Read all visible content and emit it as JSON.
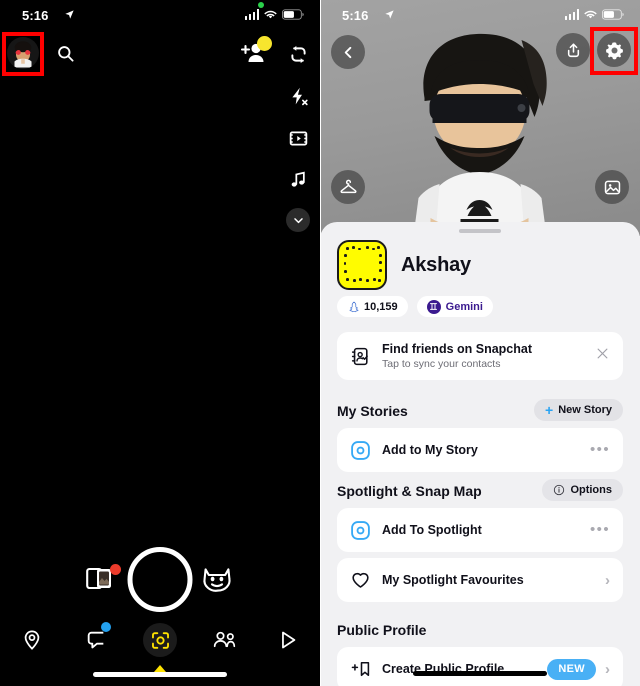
{
  "left_panel": {
    "status_bar": {
      "time": "5:16",
      "location_icon": "location-arrow-icon",
      "recording_dot": true
    },
    "top_bar": {
      "avatar_icon": "bitmoji-avatar-heart-eyes",
      "search_icon": "search-icon",
      "add_friend_icon": "add-friend-icon",
      "notification_dot_color": "#f7e52e",
      "flip_camera_icon": "flip-camera-icon",
      "flash_off_icon": "flash-off-icon",
      "timeline_icon": "timeline-icon",
      "music_icon": "music-note-icon",
      "expand_icon": "chevron-down-icon"
    },
    "capture": {
      "memories_icon": "memories-cards-icon",
      "memories_badge_color": "#ec3b2b",
      "shutter_icon": "shutter-button",
      "lens_icon": "lens-cat-face-icon"
    },
    "bottom_nav": [
      {
        "name": "map",
        "icon": "location-pin-icon",
        "active": false,
        "badge": false
      },
      {
        "name": "chat",
        "icon": "chat-bubble-icon",
        "active": false,
        "badge": true,
        "badge_color": "#23a1f0"
      },
      {
        "name": "camera",
        "icon": "camera-scan-icon",
        "active": true,
        "badge": false
      },
      {
        "name": "friends",
        "icon": "friends-icon",
        "active": false,
        "badge": false
      },
      {
        "name": "spotlight",
        "icon": "play-triangle-icon",
        "active": false,
        "badge": false
      }
    ]
  },
  "right_panel": {
    "status_bar": {
      "time": "5:16",
      "location_icon": "location-arrow-icon"
    },
    "hero": {
      "back_icon": "chevron-left-icon",
      "share_icon": "share-upload-icon",
      "settings_icon": "gear-icon",
      "wardrobe_icon": "hanger-icon",
      "background_icon": "photo-edit-icon",
      "avatar_icon": "bitmoji-3d-avatar"
    },
    "profile": {
      "snapcode_icon": "snapcode",
      "snapcode_color": "#fffc00",
      "display_name": "Akshay",
      "snapscore_icon": "snapchat-ghost-icon",
      "snapscore": "10,159",
      "zodiac_icon": "gemini-symbol",
      "zodiac": "Gemini",
      "zodiac_color": "#3b1a8f"
    },
    "find_friends": {
      "icon": "contacts-check-icon",
      "title": "Find friends on Snapchat",
      "subtitle": "Tap to sync your contacts",
      "close_icon": "close-x-icon"
    },
    "sections": [
      {
        "heading": "My Stories",
        "action": {
          "label": "New Story",
          "icon": "plus-icon"
        },
        "rows": [
          {
            "icon": "add-story-circle-icon",
            "label": "Add to My Story",
            "trailing": "more-dots-icon",
            "trailing_text": "•••"
          }
        ]
      },
      {
        "heading": "Spotlight & Snap Map",
        "action": {
          "label": "Options",
          "icon": "info-icon"
        },
        "rows": [
          {
            "icon": "add-spotlight-circle-icon",
            "label": "Add To Spotlight",
            "trailing": "more-dots-icon",
            "trailing_text": "•••"
          },
          {
            "icon": "heart-icon",
            "label": "My Spotlight Favourites",
            "trailing": "chevron-right-icon",
            "trailing_text": "›"
          }
        ]
      },
      {
        "heading": "Public Profile",
        "action": null,
        "rows": [
          {
            "icon": "add-bookmark-icon",
            "label": "Create Public Profile",
            "badge": "NEW",
            "badge_color": "#49b0f5",
            "trailing": "chevron-right-icon",
            "trailing_text": "›"
          }
        ]
      }
    ]
  },
  "annotations": {
    "highlight_color": "#ff0000",
    "boxes": [
      {
        "target": "bitmoji-avatar-button",
        "panel": "left"
      },
      {
        "target": "settings-gear-button",
        "panel": "right"
      }
    ]
  }
}
